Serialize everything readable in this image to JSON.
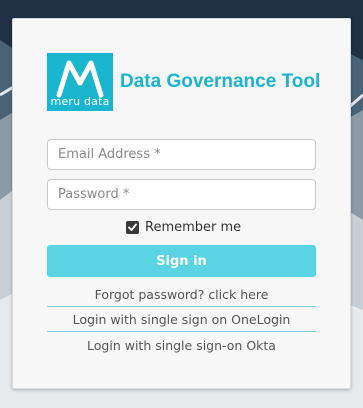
{
  "app": {
    "logo_text": "meru data",
    "title": "Data Governance Tool",
    "brand_color": "#1ab5cf"
  },
  "form": {
    "email_placeholder": "Email Address *",
    "email_value": "",
    "password_placeholder": "Password *",
    "password_value": "",
    "remember_label": "Remember me",
    "remember_checked": true,
    "signin_label": "Sign in",
    "signin_color": "#5ad3e2"
  },
  "links": {
    "forgot": "Forgot password? click here",
    "onelogin": "Login with single sign on OneLogin",
    "okta": "Login with single sign-on Okta"
  },
  "icons": {
    "logo": "mountain-m-logo-icon",
    "checkbox": "checkmark-icon"
  }
}
